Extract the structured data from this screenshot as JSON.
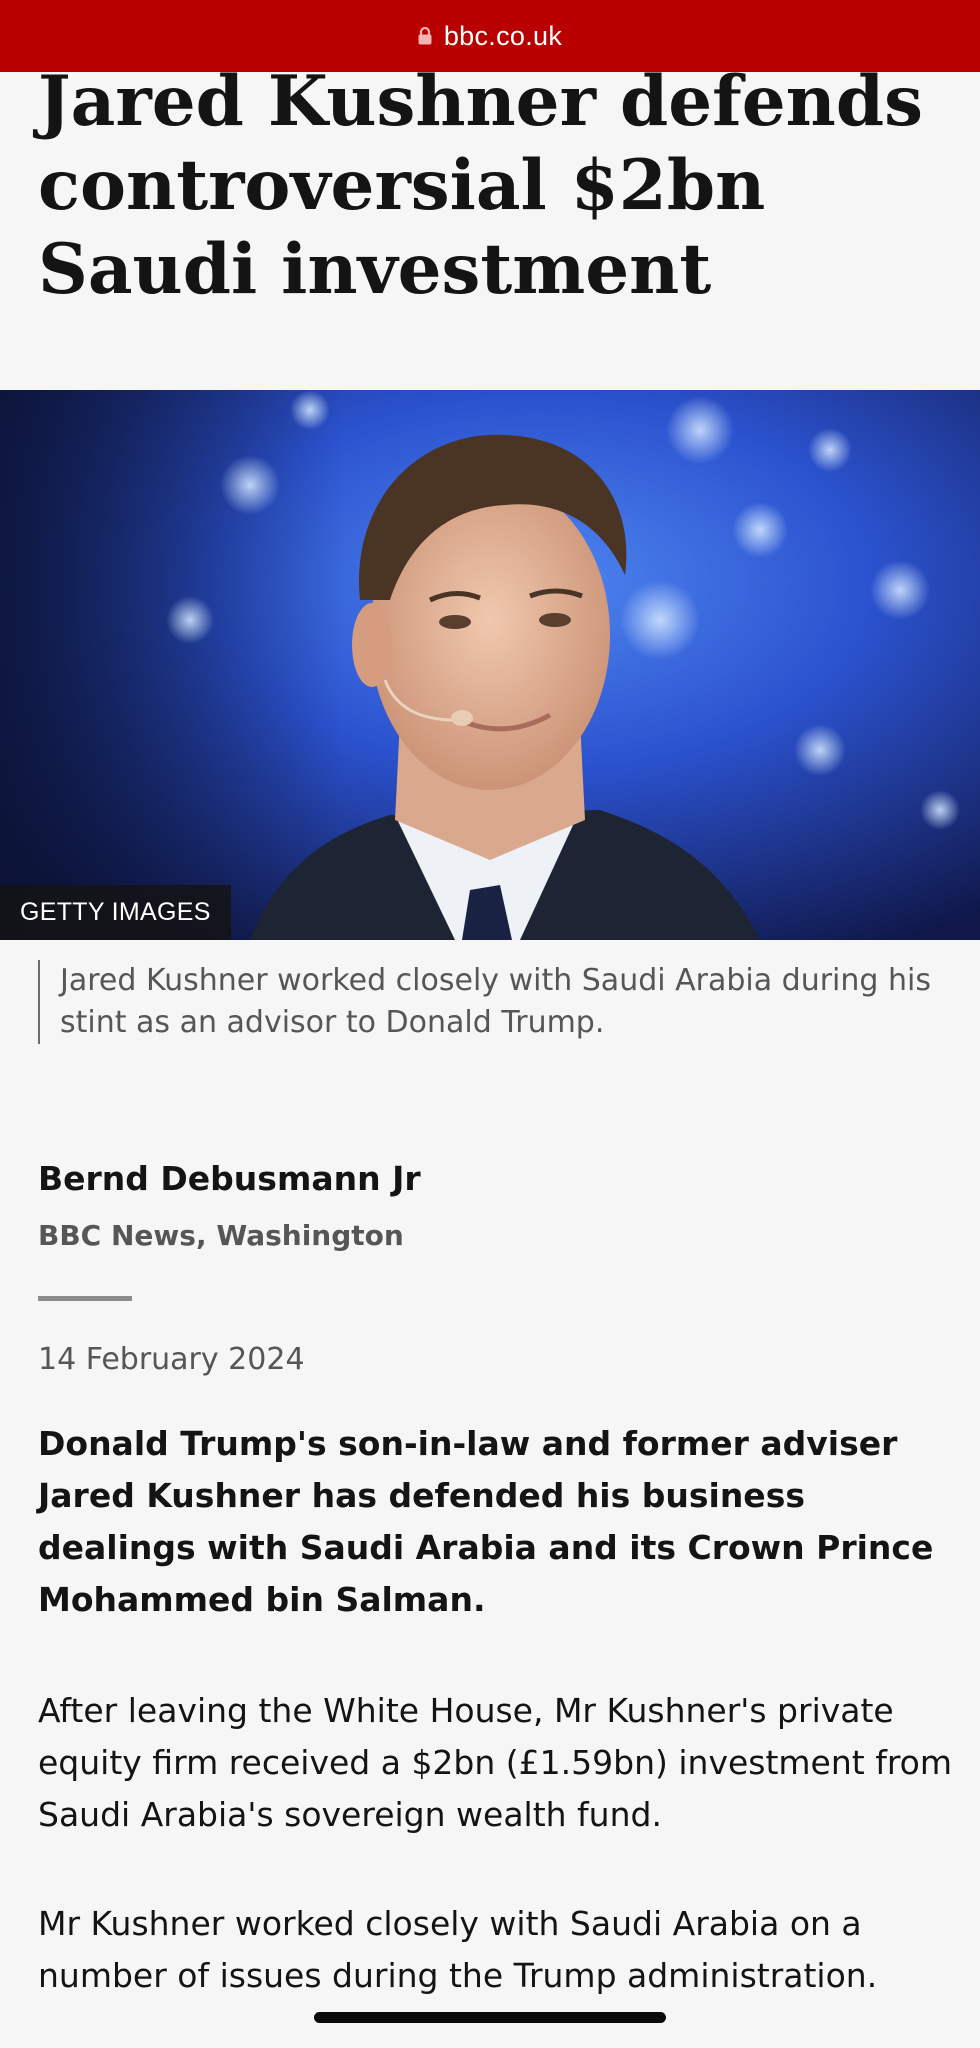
{
  "browser": {
    "url": "bbc.co.uk",
    "bar_color": "#b80000"
  },
  "article": {
    "headline": "Jared Kushner defends controversial $2bn Saudi investment",
    "image": {
      "credit": "GETTY IMAGES",
      "caption": "Jared Kushner worked closely with Saudi Arabia during his stint as an advisor to Donald Trump."
    },
    "byline": {
      "author": "Bernd Debusmann Jr",
      "affiliation": "BBC News, Washington"
    },
    "date": "14 February 2024",
    "intro": "Donald Trump's son-in-law and former adviser Jared Kushner has defended his business dealings with Saudi Arabia and its Crown Prince Mohammed bin Salman.",
    "paragraphs": [
      "After leaving the White House, Mr Kushner's private equity firm received a $2bn (£1.59bn) investment from Saudi Arabia's sovereign wealth fund.",
      "Mr Kushner worked closely with Saudi Arabia on a number of issues during the Trump administration."
    ]
  },
  "icons": {
    "lock": "lock-icon"
  }
}
